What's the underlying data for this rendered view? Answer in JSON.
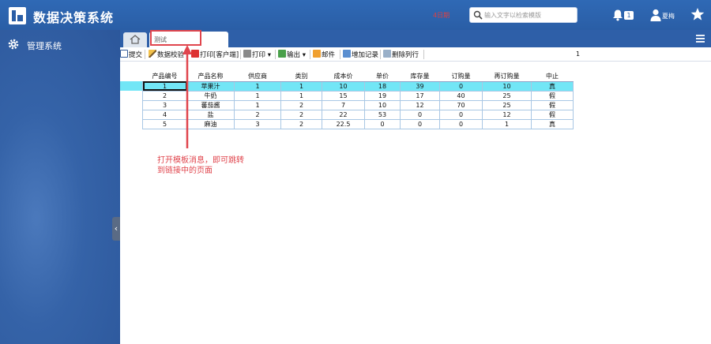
{
  "header": {
    "app_title": "数据决策系统",
    "red_note": "4日期",
    "search_placeholder": "输入文字以检索模版",
    "notification_count": "1",
    "user_name": "夏梅"
  },
  "sidebar": {
    "items": [
      {
        "label": "管理系统",
        "icon": "gear-icon"
      }
    ]
  },
  "tabs": {
    "active_label": "测试"
  },
  "toolbar": {
    "submit": "提交",
    "validate": "数据校验",
    "print_client": "打印[客户端]",
    "print": "打印",
    "export": "输出",
    "mail": "邮件",
    "add_record": "增加记录",
    "delete_row": "删除列行",
    "page_number": "1"
  },
  "table": {
    "columns": [
      "产品编号",
      "产品名称",
      "供应商",
      "类别",
      "成本价",
      "单价",
      "库存量",
      "订购量",
      "再订购量",
      "中止"
    ],
    "rows": [
      [
        "1",
        "苹果汁",
        "1",
        "1",
        "10",
        "18",
        "39",
        "0",
        "10",
        "真"
      ],
      [
        "2",
        "牛奶",
        "1",
        "1",
        "15",
        "19",
        "17",
        "40",
        "25",
        "假"
      ],
      [
        "3",
        "蕃茄酱",
        "1",
        "2",
        "7",
        "10",
        "12",
        "70",
        "25",
        "假"
      ],
      [
        "4",
        "盐",
        "2",
        "2",
        "22",
        "53",
        "0",
        "0",
        "12",
        "假"
      ],
      [
        "5",
        "麻油",
        "3",
        "2",
        "22.5",
        "0",
        "0",
        "0",
        "1",
        "真"
      ]
    ],
    "selected_row": 0
  },
  "annotation": {
    "text_line1": "打开模板消息，即可跳转",
    "text_line2": "到链接中的页面",
    "color": "#e0454d"
  },
  "colors": {
    "header_blue": "#2c60aa",
    "selection_cyan": "#72e6f6",
    "annotation_red": "#e0454d"
  }
}
